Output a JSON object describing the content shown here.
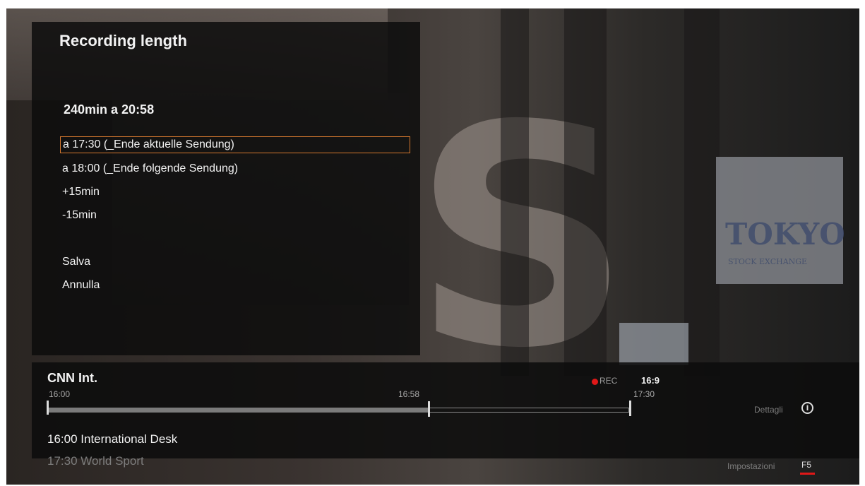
{
  "dialog": {
    "title": "Recording length",
    "current_value": "240min a 20:58",
    "options": [
      "a 17:30 (_Ende aktuelle Sendung)",
      "a 18:00 (_Ende folgende Sendung)",
      "+15min",
      "-15min"
    ],
    "selected_index": 0,
    "save_label": "Salva",
    "cancel_label": "Annulla"
  },
  "info_bar": {
    "channel": "CNN Int.",
    "rec_label": "REC",
    "aspect_ratio": "16:9",
    "timeline": {
      "start": "16:00",
      "current": "16:58",
      "end": "17:30"
    },
    "now_program": "16:00 International Desk",
    "next_program": "17:30 World Sport",
    "details_label": "Dettagli",
    "settings_label": "Impostazioni",
    "settings_key": "F5",
    "details_icon": "i"
  },
  "background": {
    "sign_word": "TOKYO",
    "sign_sub": "STOCK EXCHANGE",
    "letter": "S"
  },
  "colors": {
    "selection_border": "#d4782e",
    "rec_red": "#e01818"
  }
}
